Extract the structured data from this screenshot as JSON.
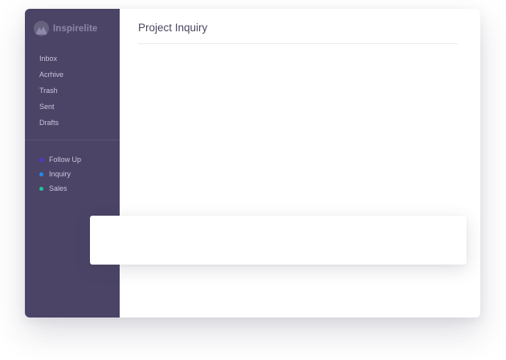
{
  "app": {
    "brand_name": "Inspirelite",
    "logo_icon": "mountain-icon"
  },
  "sidebar": {
    "folders": [
      {
        "label": "Inbox"
      },
      {
        "label": "Acrhive"
      },
      {
        "label": "Trash"
      },
      {
        "label": "Sent"
      },
      {
        "label": "Drafts"
      }
    ],
    "labels": [
      {
        "label": "Follow Up",
        "color": "#4a3bd6"
      },
      {
        "label": "Inquiry",
        "color": "#1e8cf0"
      },
      {
        "label": "Sales",
        "color": "#1fc79a"
      }
    ]
  },
  "main": {
    "title": "Project Inquiry"
  },
  "colors": {
    "sidebar_bg": "#4b4466",
    "accent": "#8f88ad"
  }
}
